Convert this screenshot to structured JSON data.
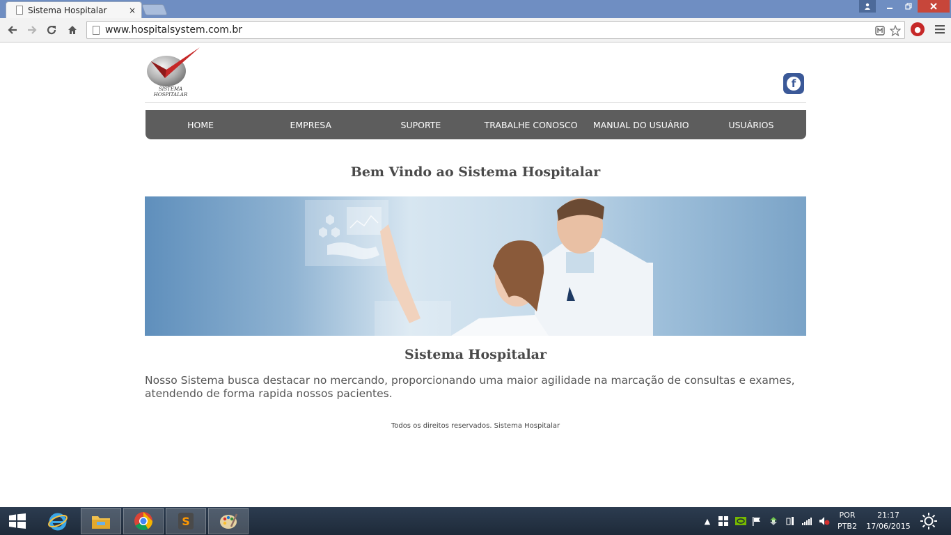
{
  "browser": {
    "tab_title": "Sistema Hospitalar",
    "tab_close": "×",
    "url": "www.hospitalsystem.com.br"
  },
  "site": {
    "logo_line1": "SISTEMA",
    "logo_line2": "HOSPITALAR",
    "facebook_glyph": "f",
    "nav": [
      "HOME",
      "EMPRESA",
      "SUPORTE",
      "TRABALHE CONOSCO",
      "MANUAL DO USUÁRIO",
      "USUÁRIOS"
    ],
    "welcome_title": "Bem Vindo ao Sistema Hospitalar",
    "section_title": "Sistema Hospitalar",
    "description": "Nosso Sistema busca destacar no mercando, proporcionando uma maior agilidade na marcação de consultas e exames, atendendo de forma rapida nossos pacientes.",
    "footer": "Todos os direitos reservados. Sistema Hospitalar"
  },
  "taskbar": {
    "lang_line1": "POR",
    "lang_line2": "PTB2",
    "time": "21:17",
    "date": "17/06/2015"
  },
  "colors": {
    "nav_bg": "#5d5d5d",
    "title_text": "#4a4a4a",
    "facebook": "#3b5998",
    "logo_red": "#c62828"
  }
}
